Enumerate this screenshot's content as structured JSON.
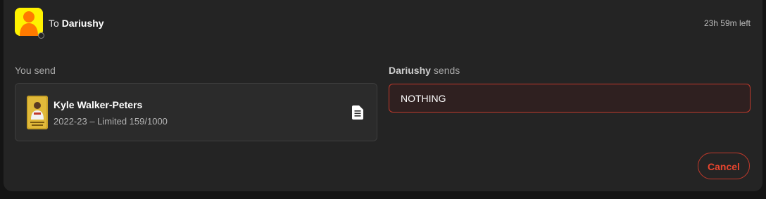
{
  "header": {
    "prefix": "To",
    "recipient": "Dariushy",
    "time_left": "23h 59m left"
  },
  "you_send": {
    "label": "You send",
    "item": {
      "name": "Kyle Walker-Peters",
      "details": "2022-23 – Limited 159/1000",
      "icon": "document-icon"
    }
  },
  "they_send": {
    "name": "Dariushy",
    "suffix": "sends",
    "value": "NOTHING"
  },
  "actions": {
    "cancel_label": "Cancel"
  },
  "colors": {
    "accent_red": "#e8452e",
    "avatar_yellow": "#fff200",
    "avatar_orange": "#ff7a00"
  }
}
